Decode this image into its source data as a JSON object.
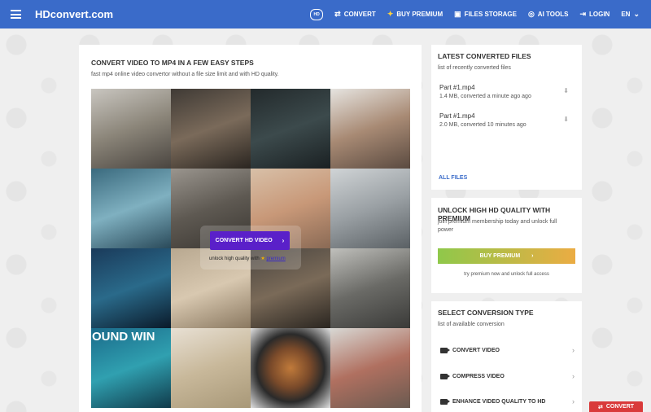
{
  "header": {
    "logo": "HDconvert.com",
    "nav": [
      {
        "icon": "hd-icon",
        "label": ""
      },
      {
        "icon": "convert-icon",
        "glyph": "⇄",
        "label": "CONVERT"
      },
      {
        "icon": "sparkle-icon",
        "glyph": "✨",
        "label": "BUY PREMIUM"
      },
      {
        "icon": "folder-icon",
        "glyph": "▣",
        "label": "FILES STORAGE"
      },
      {
        "icon": "ai-icon",
        "glyph": "◎",
        "label": "AI TOOLS"
      },
      {
        "icon": "login-icon",
        "glyph": "➜",
        "label": "LOGIN"
      },
      {
        "icon": "chevron-down-icon",
        "label": "EN"
      }
    ],
    "hd_badge": "HD"
  },
  "main": {
    "title": "CONVERT VIDEO TO MP4 IN A FEW EASY STEPS",
    "subtitle": "fast mp4 online video convertor without a file size limit and with HD quality.",
    "convert_button": "CONVERT HD VIDEO",
    "unlock_prefix": "unlock high quality with",
    "unlock_link": "premium",
    "tile_text": "OUND WIN"
  },
  "recent": {
    "title": "LATEST CONVERTED FILES",
    "subtitle": "list of recently converted files",
    "files": [
      {
        "name": "Part #1.mp4",
        "meta": "1.4 MB, converted a minute ago ago"
      },
      {
        "name": "Part #1.mp4",
        "meta": "2.0 MB, converted 10 minutes ago"
      }
    ],
    "all_files": "ALL FILES"
  },
  "premium": {
    "title": "UNLOCK HIGH HD QUALITY WITH PREMIUM",
    "description": "join premium membership today and unlock full power",
    "button": "BUY PREMIUM",
    "note": "try premium now and unlock full access"
  },
  "conversion": {
    "title": "SELECT CONVERSION TYPE",
    "subtitle": "list of available conversion",
    "items": [
      {
        "label": "CONVERT VIDEO"
      },
      {
        "label": "COMPRESS VIDEO"
      },
      {
        "label": "ENHANCE VIDEO QUALITY TO HD"
      }
    ]
  },
  "float_button": "CONVERT",
  "colors": {
    "header": "#3a6bc9",
    "accent_purple": "#5a20c9",
    "convert_red": "#d93a3a",
    "premium_gradient_start": "#8fc84a",
    "premium_gradient_end": "#ebac43"
  }
}
